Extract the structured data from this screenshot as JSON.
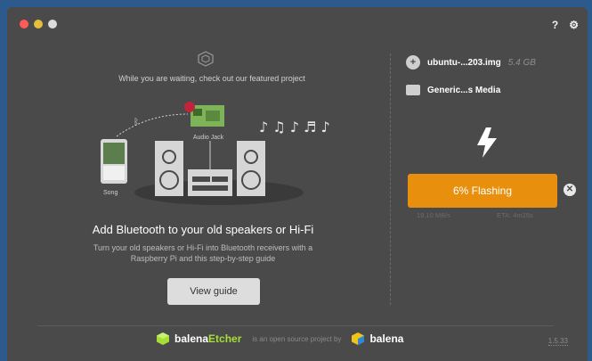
{
  "window": {
    "title_icons": [
      "help-icon",
      "settings-icon"
    ]
  },
  "featured": {
    "header": "While you are waiting, check out our featured project",
    "illustration": {
      "label_song": "Song",
      "label_audio_jack": "Audio Jack"
    },
    "title": "Add Bluetooth to your old speakers or Hi-Fi",
    "description": "Turn your old speakers or Hi-Fi into Bluetooth receivers with a Raspberry Pi and this step-by-step guide",
    "button_label": "View guide"
  },
  "image": {
    "name": "ubuntu-...203.img",
    "size": "5.4 GB"
  },
  "drive": {
    "name": "Generic...s Media"
  },
  "flash": {
    "label": "6% Flashing",
    "progress_percent": 6,
    "speed": "19.10 MB/s",
    "eta": "ETA: 4m25s"
  },
  "footer": {
    "brand_a": "balena",
    "brand_b": "Etcher",
    "middle_text": "is an open source project by",
    "company": "balena",
    "version": "1.5.33"
  },
  "colors": {
    "accent_orange": "#e8900e",
    "etcher_green": "#a5de37",
    "window_bg": "#4a4a4a"
  }
}
